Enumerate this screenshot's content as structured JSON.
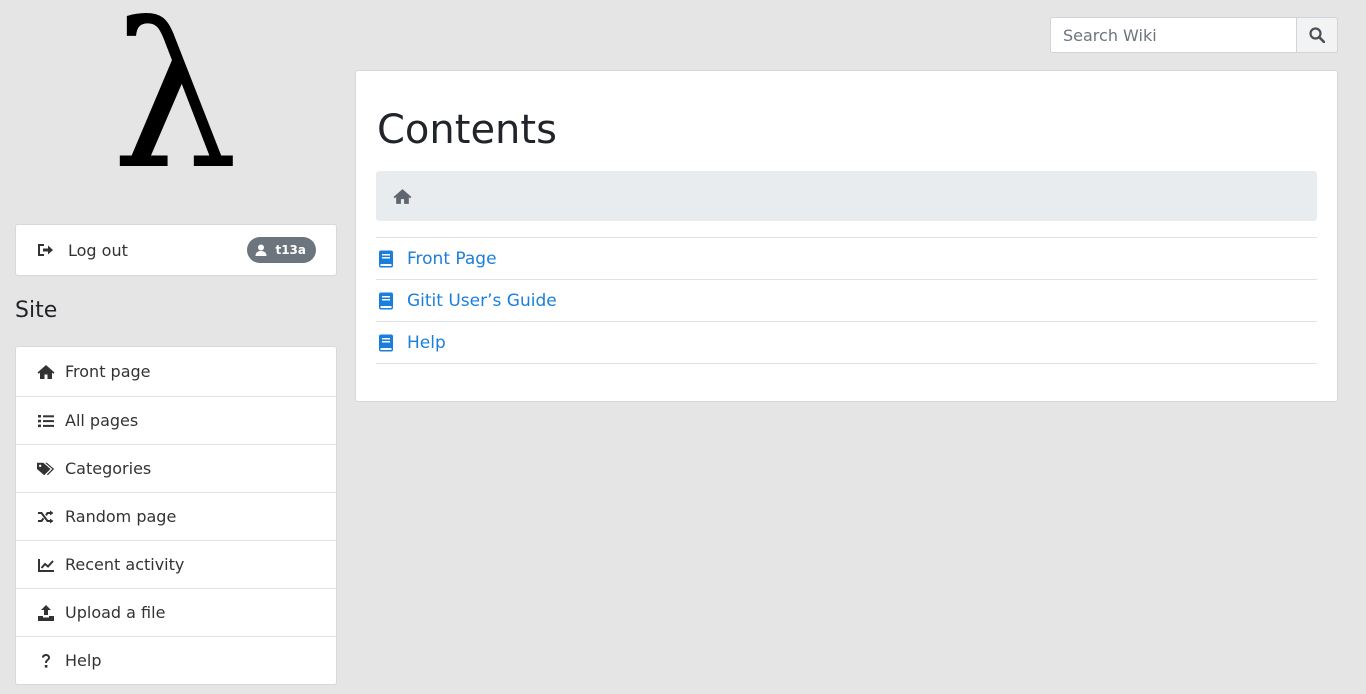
{
  "logo": {
    "glyph": "λ"
  },
  "account": {
    "logout_label": "Log out",
    "username": "t13a",
    "logout_icon": "sign-out-icon",
    "user_icon": "user-icon"
  },
  "sidebar": {
    "title": "Site",
    "items": [
      {
        "label": "Front page",
        "icon": "home-icon"
      },
      {
        "label": "All pages",
        "icon": "list-icon"
      },
      {
        "label": "Categories",
        "icon": "tags-icon"
      },
      {
        "label": "Random page",
        "icon": "random-icon"
      },
      {
        "label": "Recent activity",
        "icon": "chart-line-icon"
      },
      {
        "label": "Upload a file",
        "icon": "upload-icon"
      },
      {
        "label": "Help",
        "icon": "question-icon"
      }
    ]
  },
  "search": {
    "placeholder": "Search Wiki",
    "value": ""
  },
  "main": {
    "title": "Contents",
    "breadcrumb_icon": "home-icon",
    "pages": [
      {
        "label": "Front Page",
        "icon": "book-icon"
      },
      {
        "label": "Gitit User’s Guide",
        "icon": "book-icon"
      },
      {
        "label": "Help",
        "icon": "book-icon"
      }
    ]
  },
  "colors": {
    "background": "#e5e5e5",
    "link": "#1a7fdc",
    "badge": "#6c757d",
    "breadcrumb_bg": "#e9ecef"
  }
}
